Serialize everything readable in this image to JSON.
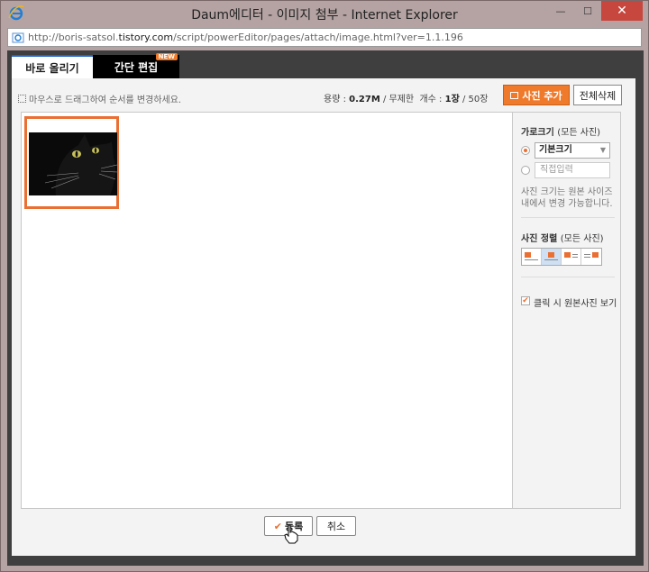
{
  "window": {
    "title": "Daum에디터 - 이미지 첨부 - Internet Explorer",
    "minimize": "—",
    "maximize": "☐",
    "close": "✕"
  },
  "address": {
    "prefix": "http://boris-satsol.",
    "domain": "tistory.com",
    "path": "/script/powerEditor/pages/attach/image.html?ver=1.1.196"
  },
  "tabs": [
    {
      "label": "바로 올리기",
      "active": true
    },
    {
      "label": "간단 편집",
      "active": false,
      "badge": "NEW"
    }
  ],
  "toolbar": {
    "hint": "마우스로 드래그하여 순서를 변경하세요.",
    "capacity_label": "용량 :",
    "capacity_value": "0.27M",
    "capacity_limit": "/ 무제한",
    "count_label": "개수 :",
    "count_value": "1장",
    "count_limit": "/ 50장",
    "add_label": "사진 추가",
    "delete_all_label": "전체삭제"
  },
  "sidebar": {
    "width_title": "가로크기",
    "width_subtitle": "(모든 사진)",
    "width_select_value": "기본크기",
    "width_input_placeholder": "직접입력",
    "width_note": "사진 크기는 원본 사이즈 내에서 변경 가능합니다.",
    "align_title": "사진 정렬",
    "align_subtitle": "(모든 사진)",
    "align_active_index": 1,
    "click_original_label": "클릭 시 원본사진 보기",
    "click_original_checked": true
  },
  "footer": {
    "submit_label": "등록",
    "cancel_label": "취소"
  },
  "colors": {
    "accent": "#ea6f32",
    "tab_border": "#1e66c8",
    "close_red": "#c7463d"
  }
}
